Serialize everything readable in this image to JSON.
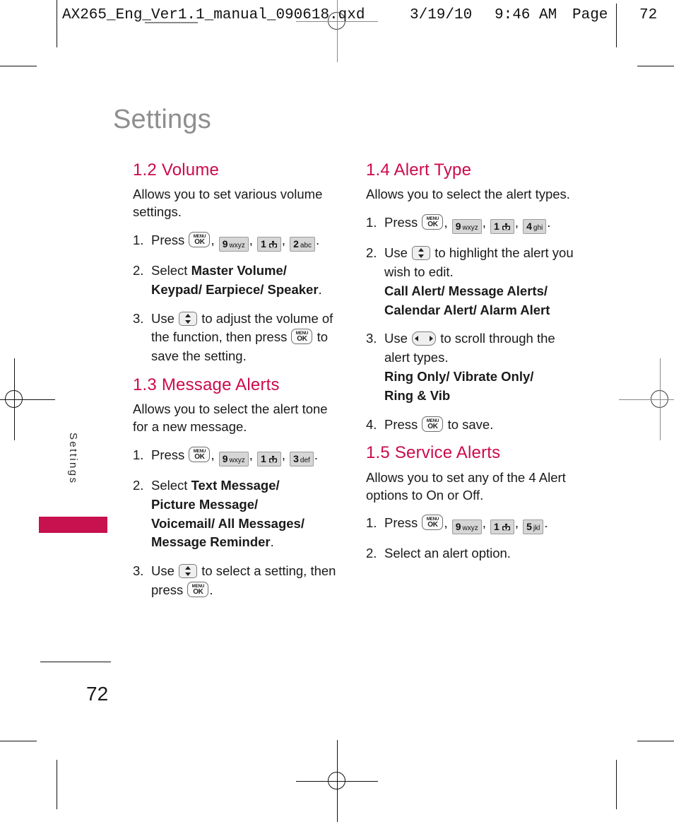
{
  "slug": {
    "filename": "AX265_Eng_Ver1.1_manual_090618.qxd",
    "date": "3/19/10",
    "time": "9:46 AM",
    "page_label": "Page",
    "page_number": "72"
  },
  "chapter": {
    "title": "Settings",
    "side_tab_label": "Settings",
    "accent_color": "#c8114f"
  },
  "heading_color": "#cc0a4c",
  "footer": {
    "page_number": "72"
  },
  "keys": {
    "ok": {
      "top": "MENU",
      "bottom": "OK"
    },
    "k1": {
      "digit": "1",
      "letters": ""
    },
    "k2": {
      "digit": "2",
      "letters": "abc"
    },
    "k3": {
      "digit": "3",
      "letters": "def"
    },
    "k4": {
      "digit": "4",
      "letters": "ghi"
    },
    "k5": {
      "digit": "5",
      "letters": "jkl"
    },
    "k9": {
      "digit": "9",
      "letters": "wxyz"
    },
    "updown_name": "up-down-navigation-key",
    "leftright_name": "left-right-navigation-key"
  },
  "left_column": {
    "section_1_2": {
      "heading": "1.2 Volume",
      "intro": "Allows you to set various volume settings.",
      "step1": {
        "num": "1.",
        "text_before": "Press",
        "comma1": ",",
        "comma2": ",",
        "comma3": ",",
        "period": "."
      },
      "step2": {
        "num": "2.",
        "text_before": "Select",
        "line1": "Master Volume/",
        "line2": "Keypad/ Earpiece/ Speaker",
        "period": "."
      },
      "step3": {
        "num": "3.",
        "text_before": "Use",
        "text_mid": "to adjust the volume of the function, then press",
        "text_after": "to save the setting."
      }
    },
    "section_1_3": {
      "heading": "1.3 Message Alerts",
      "intro": "Allows you to select the alert tone for a new message.",
      "step1": {
        "num": "1.",
        "text_before": "Press",
        "period": "."
      },
      "step2": {
        "num": "2.",
        "text_before": "Select",
        "line1": "Text Message/",
        "line2": "Picture Message/",
        "line3": "Voicemail/ All Messages/",
        "line4": "Message Reminder",
        "period": "."
      },
      "step3": {
        "num": "3.",
        "text_before": "Use",
        "text_mid": "to select a setting, then press",
        "period": "."
      }
    }
  },
  "right_column": {
    "section_1_4": {
      "heading": "1.4 Alert Type",
      "intro": "Allows you to select the alert types.",
      "step1": {
        "num": "1.",
        "text_before": "Press",
        "period": "."
      },
      "step2": {
        "num": "2.",
        "text_before": "Use",
        "text_mid": "to highlight the alert you wish to edit.",
        "options_line1": "Call Alert/ Message Alerts/",
        "options_line2": "Calendar Alert/ Alarm Alert"
      },
      "step3": {
        "num": "3.",
        "text_before": "Use",
        "text_mid": "to scroll through the alert types.",
        "options_line1": "Ring Only/ Vibrate Only/",
        "options_line2": "Ring & Vib"
      },
      "step4": {
        "num": "4.",
        "text_before": "Press",
        "text_after": "to save."
      }
    },
    "section_1_5": {
      "heading": "1.5 Service Alerts",
      "intro": "Allows you to set any of the 4 Alert options to On or Off.",
      "step1": {
        "num": "1.",
        "text_before": "Press",
        "period": "."
      },
      "step2": {
        "num": "2.",
        "text": "Select an alert option."
      }
    }
  }
}
